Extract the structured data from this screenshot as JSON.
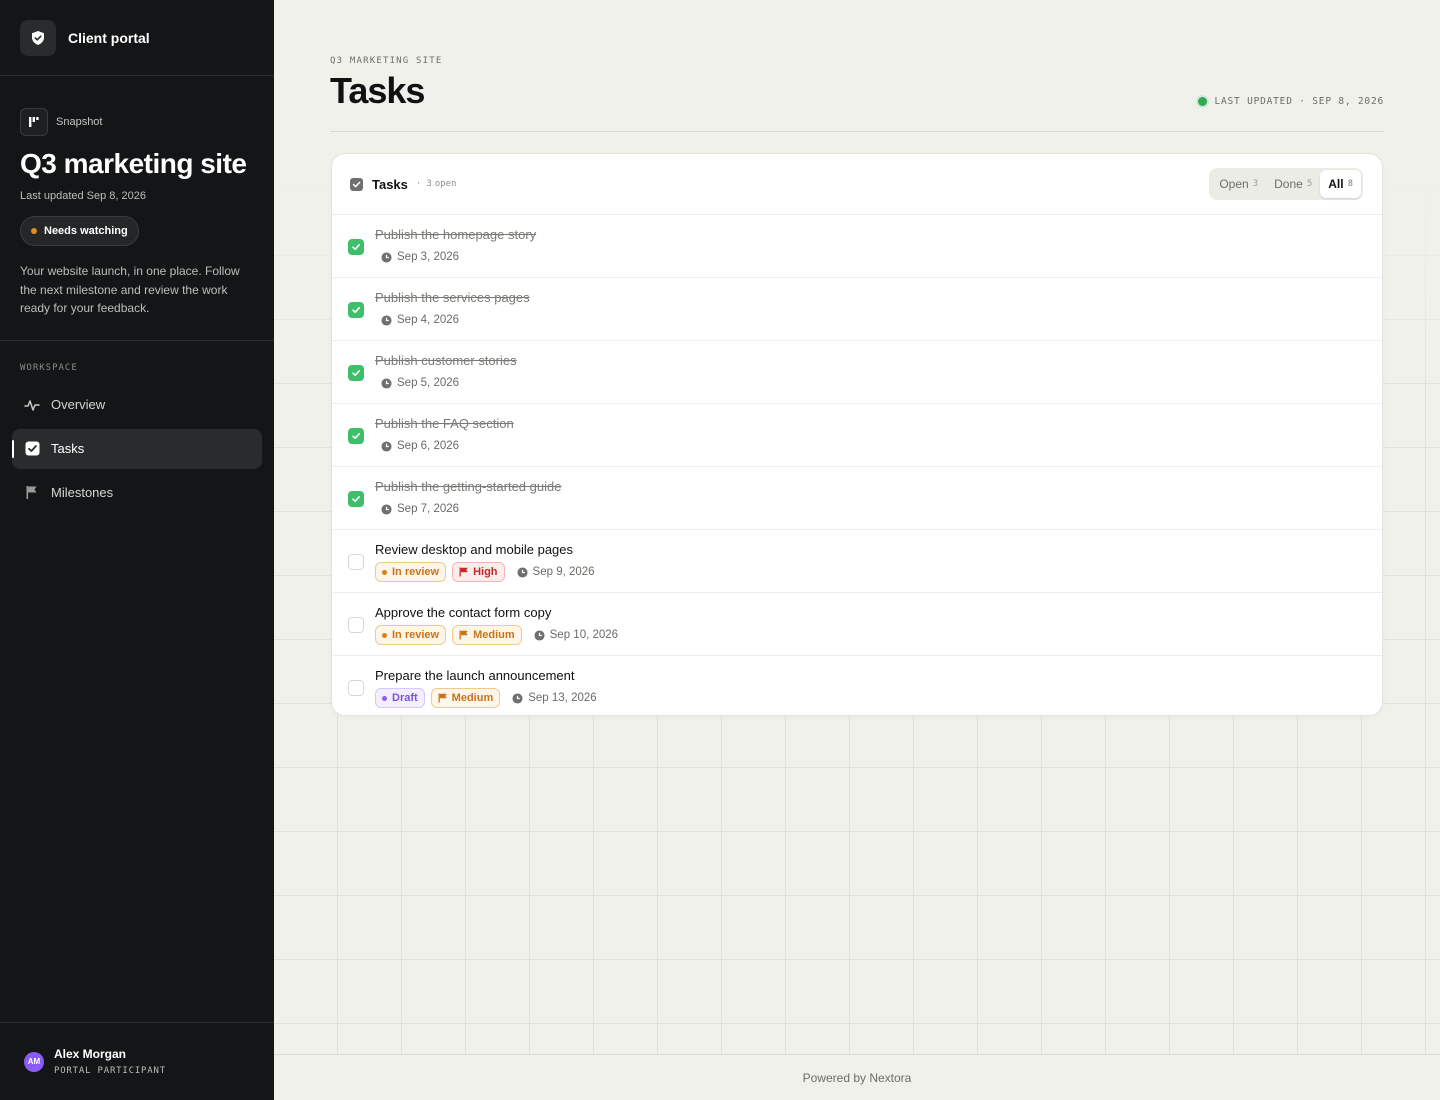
{
  "brand": {
    "name": "Client portal",
    "logo_icon": "shield-check-icon"
  },
  "project": {
    "snapshot_label": "Snapshot",
    "title": "Q3 marketing site",
    "updated": "Last updated Sep 8, 2026",
    "status": "Needs watching",
    "status_color": "#e78a1e",
    "description": "Your website launch, in one place. Follow the next milestone and review the work ready for your feedback."
  },
  "nav": {
    "section": "WORKSPACE",
    "items": [
      {
        "label": "Overview",
        "icon": "activity-icon",
        "active": false
      },
      {
        "label": "Tasks",
        "icon": "checkbox-icon",
        "active": true
      },
      {
        "label": "Milestones",
        "icon": "flag-icon",
        "active": false
      }
    ]
  },
  "user": {
    "initials": "AM",
    "name": "Alex Morgan",
    "role": "PORTAL PARTICIPANT",
    "avatar_color": "#8a5cf6"
  },
  "header": {
    "eyebrow": "Q3 MARKETING SITE",
    "title": "Tasks",
    "last_updated": "LAST UPDATED · SEP 8, 2026"
  },
  "card": {
    "title": "Tasks",
    "open_sep": "·",
    "open_count": "3",
    "open_label": "open",
    "filters": [
      {
        "label": "Open",
        "count": "3",
        "active": false
      },
      {
        "label": "Done",
        "count": "5",
        "active": false
      },
      {
        "label": "All",
        "count": "8",
        "active": true
      }
    ]
  },
  "tasks": [
    {
      "name": "Publish the homepage story",
      "done": true,
      "date": "Sep 3, 2026"
    },
    {
      "name": "Publish the services pages",
      "done": true,
      "date": "Sep 4, 2026"
    },
    {
      "name": "Publish customer stories",
      "done": true,
      "date": "Sep 5, 2026"
    },
    {
      "name": "Publish the FAQ section",
      "done": true,
      "date": "Sep 6, 2026"
    },
    {
      "name": "Publish the getting-started guide",
      "done": true,
      "date": "Sep 7, 2026"
    },
    {
      "name": "Review desktop and mobile pages",
      "done": false,
      "status": "In review",
      "priority": "High",
      "date": "Sep 9, 2026"
    },
    {
      "name": "Approve the contact form copy",
      "done": false,
      "status": "In review",
      "priority": "Medium",
      "date": "Sep 10, 2026"
    },
    {
      "name": "Prepare the launch announcement",
      "done": false,
      "status": "Draft",
      "priority": "Medium",
      "date": "Sep 13, 2026"
    }
  ],
  "footer": {
    "text": "Powered by Nextora"
  }
}
